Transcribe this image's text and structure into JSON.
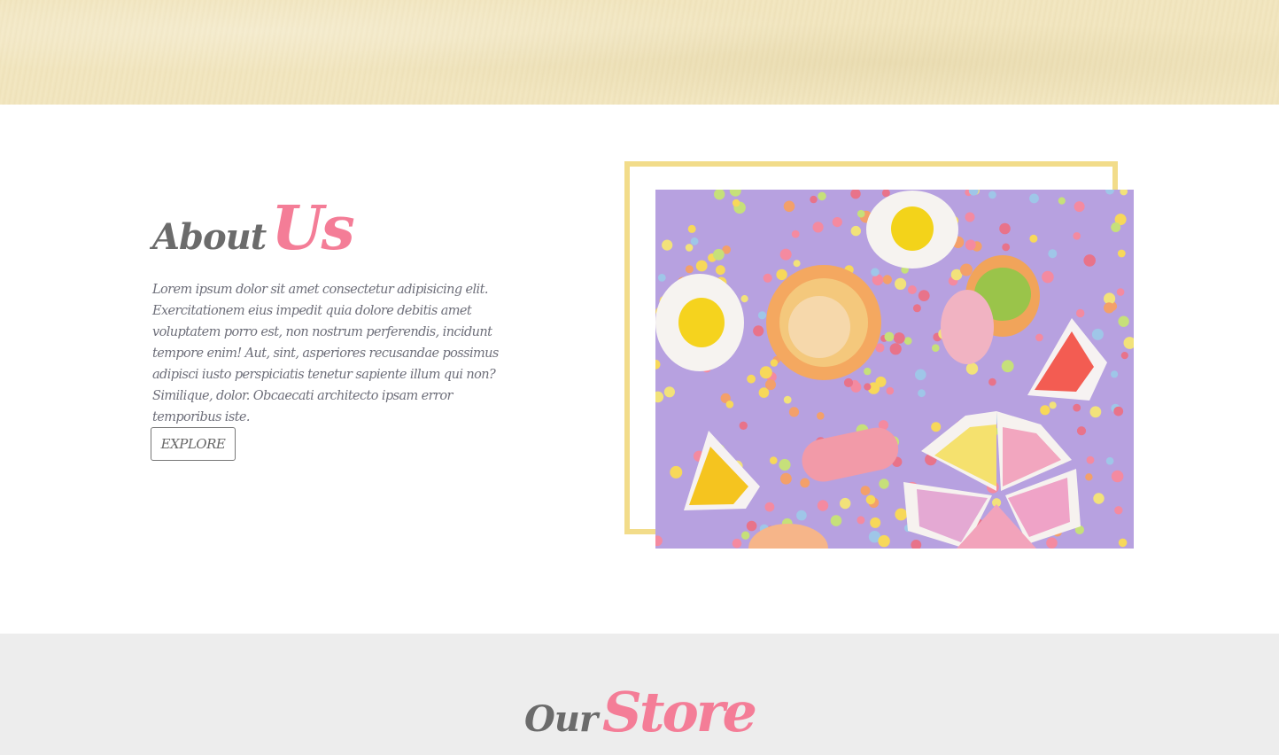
{
  "about": {
    "title_plain": "About",
    "title_accent": "Us",
    "paragraph": "Lorem ipsum dolor sit amet consectetur adipisicing elit. Exercitationem eius impedit quia dolore debitis amet voluptatem porro est, non nostrum perferendis, incidunt tempore enim! Aut, sint, asperiores recusandae possimus adipisci iusto perspiciatis tenetur sapiente illum qui non? Similique, dolor. Obcaecati architecto ipsam error temporibus iste.",
    "button_label": "EXPLORE"
  },
  "store": {
    "title_plain": "Our",
    "title_accent": "Store"
  },
  "colors": {
    "accent_pink": "#f47d97",
    "heading_gray": "#6b6b6b",
    "frame_yellow": "#f2dc8a",
    "banner_cream": "#f1e5bf",
    "store_bg": "#ededed"
  }
}
